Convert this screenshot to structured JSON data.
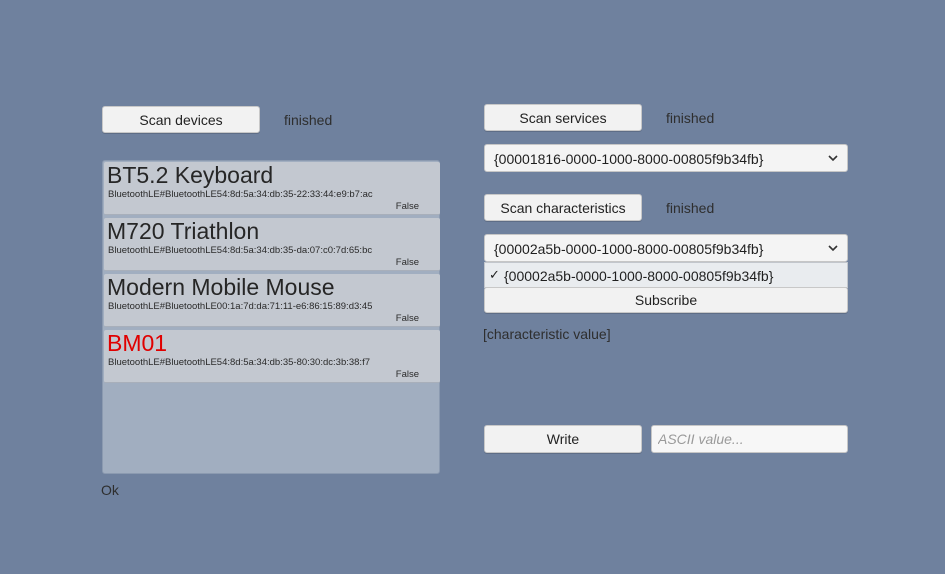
{
  "left": {
    "scan_devices_label": "Scan devices",
    "scan_devices_status": "finished",
    "devices": [
      {
        "name": "BT5.2 Keyboard",
        "address": "BluetoothLE#BluetoothLE54:8d:5a:34:db:35-22:33:44:e9:b7:ac",
        "flag": "False",
        "color": "#262626"
      },
      {
        "name": "M720 Triathlon",
        "address": "BluetoothLE#BluetoothLE54:8d:5a:34:db:35-da:07:c0:7d:65:bc",
        "flag": "False",
        "color": "#262626"
      },
      {
        "name": "Modern Mobile Mouse",
        "address": "BluetoothLE#BluetoothLE00:1a:7d:da:71:11-e6:86:15:89:d3:45",
        "flag": "False",
        "color": "#262626"
      },
      {
        "name": "BM01",
        "address": "BluetoothLE#BluetoothLE54:8d:5a:34:db:35-80:30:dc:3b:38:f7",
        "flag": "False",
        "color": "#e00000"
      }
    ],
    "footer_status": "Ok"
  },
  "right": {
    "scan_services_label": "Scan services",
    "scan_services_status": "finished",
    "service_selected": "{00001816-0000-1000-8000-00805f9b34fb}",
    "scan_characteristics_label": "Scan characteristics",
    "scan_characteristics_status": "finished",
    "characteristic_selected": "{00002a5b-0000-1000-8000-00805f9b34fb}",
    "characteristic_options": [
      {
        "label": "{00002a5b-0000-1000-8000-00805f9b34fb}",
        "check": "✓"
      }
    ],
    "subscribe_label": "Subscribe",
    "characteristic_value": "[characteristic value]",
    "write_label": "Write",
    "ascii_placeholder": "ASCII value..."
  },
  "icons": {
    "dropdown_chevron": "chevron-down-icon",
    "checkmark": "checkmark-icon"
  },
  "colors": {
    "background": "#6f819e",
    "highlight_device_name": "#e00000"
  }
}
